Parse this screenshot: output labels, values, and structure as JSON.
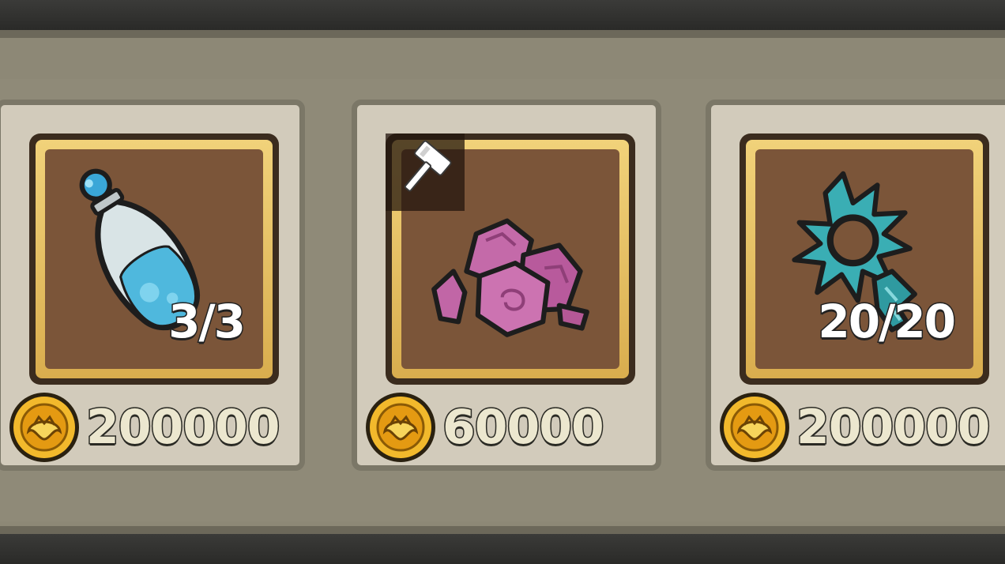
{
  "shop": {
    "items": [
      {
        "name_icon": "blue-potion-icon",
        "count": "3/3",
        "price": "200000",
        "currency_icon": "gold-coin-icon"
      },
      {
        "name_icon": "purple-ore-crystals-icon",
        "badge_icon": "hammer-icon",
        "price": "60000",
        "currency_icon": "gold-coin-icon"
      },
      {
        "name_icon": "teal-spiked-ring-key-icon",
        "count": "20/20",
        "price": "200000",
        "currency_icon": "gold-coin-icon"
      }
    ]
  },
  "colors": {
    "card_bg": "#d2cbbb",
    "slot_gold": "#e8c465",
    "slot_brown": "#7b5539",
    "price_text": "#ece7cf",
    "count_text": "#ffffff"
  }
}
